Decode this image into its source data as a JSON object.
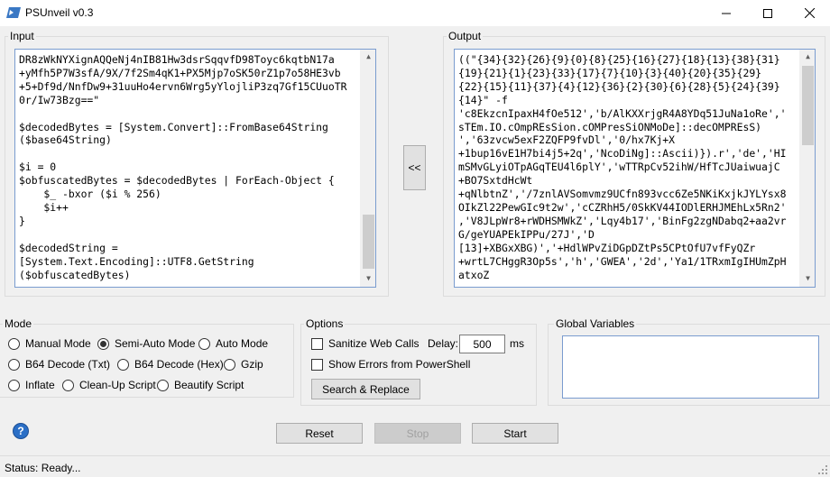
{
  "window": {
    "title": "PSUnveil v0.3",
    "icon": "powershell-app-icon",
    "controls": {
      "minimize": "minimize-icon",
      "maximize": "maximize-icon",
      "close": "close-icon"
    }
  },
  "input": {
    "label": "Input",
    "text": "DR8zWkNYXignAQQeNj4nIB81Hw3dsrSqqvfD98Toyc6kqtbN17a\n+yMfh5P7W3sfA/9X/7f2Sm4qK1+PX5Mjp7oSK50rZ1p7o58HE3vb\n+5+Df9d/NnfDw9+31uuHo4ervn6Wrg5yYlojliP3zq7Gf15CUuoTR\n0r/Iw73Bzg==\"\n\n$decodedBytes = [System.Convert]::FromBase64String\n($base64String)\n\n$i = 0\n$obfuscatedBytes = $decodedBytes | ForEach-Object {\n    $_ -bxor ($i % 256)\n    $i++\n}\n\n$decodedString =\n[System.Text.Encoding]::UTF8.GetString\n($obfuscatedBytes)"
  },
  "output": {
    "label": "Output",
    "text": "((\"{34}{32}{26}{9}{0}{8}{25}{16}{27}{18}{13}{38}{31}\n{19}{21}{1}{23}{33}{17}{7}{10}{3}{40}{20}{35}{29}\n{22}{15}{11}{37}{4}{12}{36}{2}{30}{6}{28}{5}{24}{39}\n{14}\" -f\n'c8EkzcnIpaxH4fOe512','b/AlKXXrjgR4A8YDq51JuNa1oRe','\nsTEm.IO.cOmpREsSion.cOMPresSiONMoDe]::decOMPREsS)\n','63zvcw5exF2ZQFP9fvDl','0/hx7Kj+X\n+1bup16vE1H7bi4j5+2q','NcoDiNg]::Ascii)}).r','de','HI\nmSMvGLyiOTpAGqTEU4l6plY','wTTRpCv52ihW/HfTcJUaiwuajC\n+BO7SxtdHcWt\n+qNlbtnZ','/7znlAVSomvmz9UCfn893vcc6Ze5NKiKxjkJYLYsx8\nOIkZl22PewGIc9t2w','cCZRhH5/0SkKV44IODlERHJMEhLx5Rn2'\n,'V8JLpWr8+rWDHSMWkZ','Lqy4b17','BinFg2zgNDabq2+aa2vr\nG/geYUAPEkIPPu/27J','D\n[13]+XBGxXBG)','+HdlWPvZiDGpDZtPs5CPtOfU7vfFyQZr\n+wrtL7CHggR3Op5s','h','GWEA','2d','Ya1/1TRxmIgIHUmZpH\natxoZ"
  },
  "copy_button": {
    "label": "<<"
  },
  "mode": {
    "label": "Mode",
    "options": [
      "Manual Mode",
      "Semi-Auto Mode",
      "Auto Mode",
      "B64 Decode (Txt)",
      "B64 Decode (Hex)",
      "Gzip",
      "Inflate",
      "Clean-Up Script",
      "Beautify Script"
    ],
    "selected": "Semi-Auto Mode"
  },
  "options": {
    "label": "Options",
    "sanitize_label": "Sanitize Web Calls",
    "delay_label": "Delay:",
    "delay_value": "500",
    "delay_unit": "ms",
    "show_errors_label": "Show Errors from PowerShell",
    "search_replace_label": "Search & Replace"
  },
  "global_variables": {
    "label": "Global Variables",
    "value": ""
  },
  "actions": {
    "reset": "Reset",
    "stop": "Stop",
    "start": "Start",
    "help_icon": "help-icon",
    "help_glyph": "?"
  },
  "status": {
    "text": "Status: Ready..."
  }
}
